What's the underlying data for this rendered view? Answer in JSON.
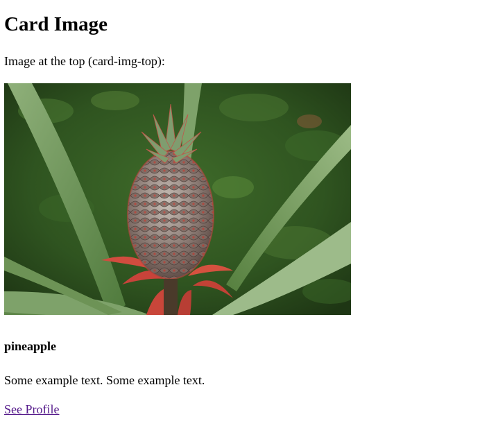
{
  "page": {
    "title": "Card Image",
    "intro": "Image at the top (card-img-top):"
  },
  "card": {
    "image": {
      "subject": "pineapple-plant-photo"
    },
    "title": "pineapple",
    "text": "Some example text. Some example text.",
    "link_label": "See Profile"
  },
  "colors": {
    "link_visited": "#551a8b",
    "text": "#000000",
    "background": "#ffffff"
  }
}
